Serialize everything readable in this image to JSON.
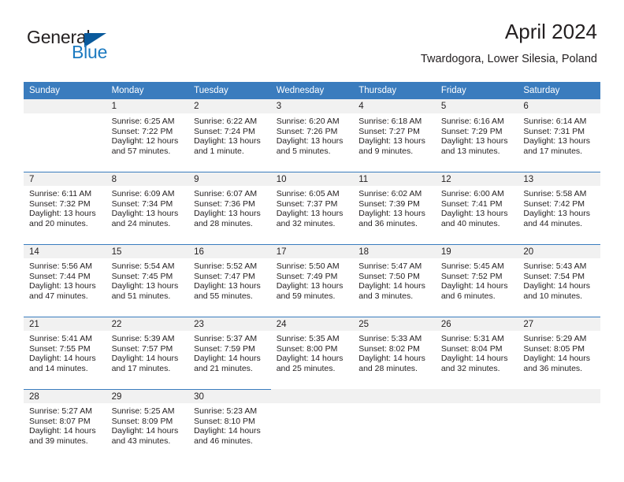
{
  "logo": {
    "word_top": "General",
    "word_bottom": "Blue",
    "triangle_color": "#0a5a9c",
    "blue_color": "#1c7ac0"
  },
  "header": {
    "title": "April 2024",
    "subtitle": "Twardogora, Lower Silesia, Poland"
  },
  "theme": {
    "header_row_bg": "#3a7cbe",
    "daynum_band_bg": "#f1f1f1",
    "text_color": "#231f20"
  },
  "weekday_headers": [
    "Sunday",
    "Monday",
    "Tuesday",
    "Wednesday",
    "Thursday",
    "Friday",
    "Saturday"
  ],
  "weeks": [
    [
      {
        "day": "",
        "sunrise": "",
        "sunset": "",
        "daylight_line1": "",
        "daylight_line2": ""
      },
      {
        "day": "1",
        "sunrise": "Sunrise: 6:25 AM",
        "sunset": "Sunset: 7:22 PM",
        "daylight_line1": "Daylight: 12 hours",
        "daylight_line2": "and 57 minutes."
      },
      {
        "day": "2",
        "sunrise": "Sunrise: 6:22 AM",
        "sunset": "Sunset: 7:24 PM",
        "daylight_line1": "Daylight: 13 hours",
        "daylight_line2": "and 1 minute."
      },
      {
        "day": "3",
        "sunrise": "Sunrise: 6:20 AM",
        "sunset": "Sunset: 7:26 PM",
        "daylight_line1": "Daylight: 13 hours",
        "daylight_line2": "and 5 minutes."
      },
      {
        "day": "4",
        "sunrise": "Sunrise: 6:18 AM",
        "sunset": "Sunset: 7:27 PM",
        "daylight_line1": "Daylight: 13 hours",
        "daylight_line2": "and 9 minutes."
      },
      {
        "day": "5",
        "sunrise": "Sunrise: 6:16 AM",
        "sunset": "Sunset: 7:29 PM",
        "daylight_line1": "Daylight: 13 hours",
        "daylight_line2": "and 13 minutes."
      },
      {
        "day": "6",
        "sunrise": "Sunrise: 6:14 AM",
        "sunset": "Sunset: 7:31 PM",
        "daylight_line1": "Daylight: 13 hours",
        "daylight_line2": "and 17 minutes."
      }
    ],
    [
      {
        "day": "7",
        "sunrise": "Sunrise: 6:11 AM",
        "sunset": "Sunset: 7:32 PM",
        "daylight_line1": "Daylight: 13 hours",
        "daylight_line2": "and 20 minutes."
      },
      {
        "day": "8",
        "sunrise": "Sunrise: 6:09 AM",
        "sunset": "Sunset: 7:34 PM",
        "daylight_line1": "Daylight: 13 hours",
        "daylight_line2": "and 24 minutes."
      },
      {
        "day": "9",
        "sunrise": "Sunrise: 6:07 AM",
        "sunset": "Sunset: 7:36 PM",
        "daylight_line1": "Daylight: 13 hours",
        "daylight_line2": "and 28 minutes."
      },
      {
        "day": "10",
        "sunrise": "Sunrise: 6:05 AM",
        "sunset": "Sunset: 7:37 PM",
        "daylight_line1": "Daylight: 13 hours",
        "daylight_line2": "and 32 minutes."
      },
      {
        "day": "11",
        "sunrise": "Sunrise: 6:02 AM",
        "sunset": "Sunset: 7:39 PM",
        "daylight_line1": "Daylight: 13 hours",
        "daylight_line2": "and 36 minutes."
      },
      {
        "day": "12",
        "sunrise": "Sunrise: 6:00 AM",
        "sunset": "Sunset: 7:41 PM",
        "daylight_line1": "Daylight: 13 hours",
        "daylight_line2": "and 40 minutes."
      },
      {
        "day": "13",
        "sunrise": "Sunrise: 5:58 AM",
        "sunset": "Sunset: 7:42 PM",
        "daylight_line1": "Daylight: 13 hours",
        "daylight_line2": "and 44 minutes."
      }
    ],
    [
      {
        "day": "14",
        "sunrise": "Sunrise: 5:56 AM",
        "sunset": "Sunset: 7:44 PM",
        "daylight_line1": "Daylight: 13 hours",
        "daylight_line2": "and 47 minutes."
      },
      {
        "day": "15",
        "sunrise": "Sunrise: 5:54 AM",
        "sunset": "Sunset: 7:45 PM",
        "daylight_line1": "Daylight: 13 hours",
        "daylight_line2": "and 51 minutes."
      },
      {
        "day": "16",
        "sunrise": "Sunrise: 5:52 AM",
        "sunset": "Sunset: 7:47 PM",
        "daylight_line1": "Daylight: 13 hours",
        "daylight_line2": "and 55 minutes."
      },
      {
        "day": "17",
        "sunrise": "Sunrise: 5:50 AM",
        "sunset": "Sunset: 7:49 PM",
        "daylight_line1": "Daylight: 13 hours",
        "daylight_line2": "and 59 minutes."
      },
      {
        "day": "18",
        "sunrise": "Sunrise: 5:47 AM",
        "sunset": "Sunset: 7:50 PM",
        "daylight_line1": "Daylight: 14 hours",
        "daylight_line2": "and 3 minutes."
      },
      {
        "day": "19",
        "sunrise": "Sunrise: 5:45 AM",
        "sunset": "Sunset: 7:52 PM",
        "daylight_line1": "Daylight: 14 hours",
        "daylight_line2": "and 6 minutes."
      },
      {
        "day": "20",
        "sunrise": "Sunrise: 5:43 AM",
        "sunset": "Sunset: 7:54 PM",
        "daylight_line1": "Daylight: 14 hours",
        "daylight_line2": "and 10 minutes."
      }
    ],
    [
      {
        "day": "21",
        "sunrise": "Sunrise: 5:41 AM",
        "sunset": "Sunset: 7:55 PM",
        "daylight_line1": "Daylight: 14 hours",
        "daylight_line2": "and 14 minutes."
      },
      {
        "day": "22",
        "sunrise": "Sunrise: 5:39 AM",
        "sunset": "Sunset: 7:57 PM",
        "daylight_line1": "Daylight: 14 hours",
        "daylight_line2": "and 17 minutes."
      },
      {
        "day": "23",
        "sunrise": "Sunrise: 5:37 AM",
        "sunset": "Sunset: 7:59 PM",
        "daylight_line1": "Daylight: 14 hours",
        "daylight_line2": "and 21 minutes."
      },
      {
        "day": "24",
        "sunrise": "Sunrise: 5:35 AM",
        "sunset": "Sunset: 8:00 PM",
        "daylight_line1": "Daylight: 14 hours",
        "daylight_line2": "and 25 minutes."
      },
      {
        "day": "25",
        "sunrise": "Sunrise: 5:33 AM",
        "sunset": "Sunset: 8:02 PM",
        "daylight_line1": "Daylight: 14 hours",
        "daylight_line2": "and 28 minutes."
      },
      {
        "day": "26",
        "sunrise": "Sunrise: 5:31 AM",
        "sunset": "Sunset: 8:04 PM",
        "daylight_line1": "Daylight: 14 hours",
        "daylight_line2": "and 32 minutes."
      },
      {
        "day": "27",
        "sunrise": "Sunrise: 5:29 AM",
        "sunset": "Sunset: 8:05 PM",
        "daylight_line1": "Daylight: 14 hours",
        "daylight_line2": "and 36 minutes."
      }
    ],
    [
      {
        "day": "28",
        "sunrise": "Sunrise: 5:27 AM",
        "sunset": "Sunset: 8:07 PM",
        "daylight_line1": "Daylight: 14 hours",
        "daylight_line2": "and 39 minutes."
      },
      {
        "day": "29",
        "sunrise": "Sunrise: 5:25 AM",
        "sunset": "Sunset: 8:09 PM",
        "daylight_line1": "Daylight: 14 hours",
        "daylight_line2": "and 43 minutes."
      },
      {
        "day": "30",
        "sunrise": "Sunrise: 5:23 AM",
        "sunset": "Sunset: 8:10 PM",
        "daylight_line1": "Daylight: 14 hours",
        "daylight_line2": "and 46 minutes."
      },
      {
        "day": "",
        "sunrise": "",
        "sunset": "",
        "daylight_line1": "",
        "daylight_line2": ""
      },
      {
        "day": "",
        "sunrise": "",
        "sunset": "",
        "daylight_line1": "",
        "daylight_line2": ""
      },
      {
        "day": "",
        "sunrise": "",
        "sunset": "",
        "daylight_line1": "",
        "daylight_line2": ""
      },
      {
        "day": "",
        "sunrise": "",
        "sunset": "",
        "daylight_line1": "",
        "daylight_line2": ""
      }
    ]
  ]
}
